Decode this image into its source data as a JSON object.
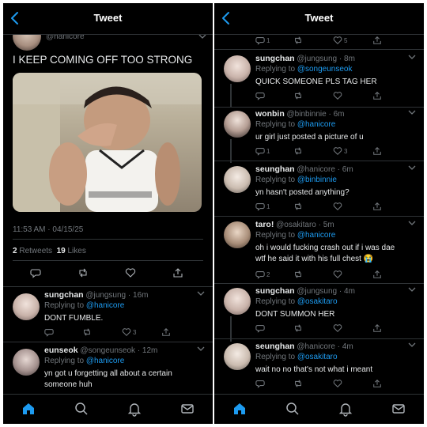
{
  "left": {
    "header": {
      "title": "Tweet"
    },
    "main_tweet": {
      "handle": "@hanicore",
      "text": "I KEEP COMING OFF TOO STRONG",
      "timestamp": "11:53 AM · 04/15/25",
      "retweets_count": "2",
      "retweets_label": "Retweets",
      "likes_count": "19",
      "likes_label": "Likes"
    },
    "replies": [
      {
        "name": "sungchan",
        "handle": "@jungsung",
        "time": "· 16m",
        "replying_prefix": "Replying to",
        "replying_to": "@hanicore",
        "text": "DONT FUMBLE.",
        "like_count": "3"
      },
      {
        "name": "eunseok",
        "handle": "@songeunseok",
        "time": "· 12m",
        "replying_prefix": "Replying to",
        "replying_to": "@hanicore",
        "text": "yn got u forgetting all about a certain someone huh"
      }
    ]
  },
  "right": {
    "header": {
      "title": "Tweet"
    },
    "top_actions": {
      "reply_count": "1",
      "like_count": "5"
    },
    "replies": [
      {
        "name": "sungchan",
        "handle": "@jungsung",
        "time": "· 8m",
        "replying_prefix": "Replying to",
        "replying_to": "@songeunseok",
        "text": "QUICK SOMEONE PLS TAG HER"
      },
      {
        "name": "wonbin",
        "handle": "@binbinnie",
        "time": "· 6m",
        "replying_prefix": "Replying to",
        "replying_to": "@hanicore",
        "text": "ur girl just posted a picture of u",
        "reply_count": "1",
        "like_count": "3"
      },
      {
        "name": "seunghan",
        "handle": "@hanicore",
        "time": "· 6m",
        "replying_prefix": "Replying to",
        "replying_to": "@binbinnie",
        "text": "yn hasn't posted anything?",
        "reply_count": "1"
      },
      {
        "name": "taro!",
        "handle": "@osakitaro",
        "time": "· 5m",
        "replying_prefix": "Replying to",
        "replying_to": "@hanicore",
        "text": "oh i would fucking crash out if i was dae wtf he said it with his full chest 😭",
        "reply_count": "2"
      },
      {
        "name": "sungchan",
        "handle": "@jungsung",
        "time": "· 4m",
        "replying_prefix": "Replying to",
        "replying_to": "@osakitaro",
        "text": "DONT SUMMON HER"
      },
      {
        "name": "seunghan",
        "handle": "@hanicore",
        "time": "· 4m",
        "replying_prefix": "Replying to",
        "replying_to": "@osakitaro",
        "text": "wait no no that's not what i meant"
      }
    ]
  },
  "colors": {
    "accent": "#1d9bf0",
    "background": "#000000",
    "muted": "#71767b",
    "divider": "#2f3336"
  },
  "icons": [
    "back-arrow-icon",
    "reply-icon",
    "retweet-icon",
    "like-icon",
    "share-icon",
    "home-icon",
    "search-icon",
    "notifications-icon",
    "messages-icon",
    "chevron-down-icon"
  ]
}
